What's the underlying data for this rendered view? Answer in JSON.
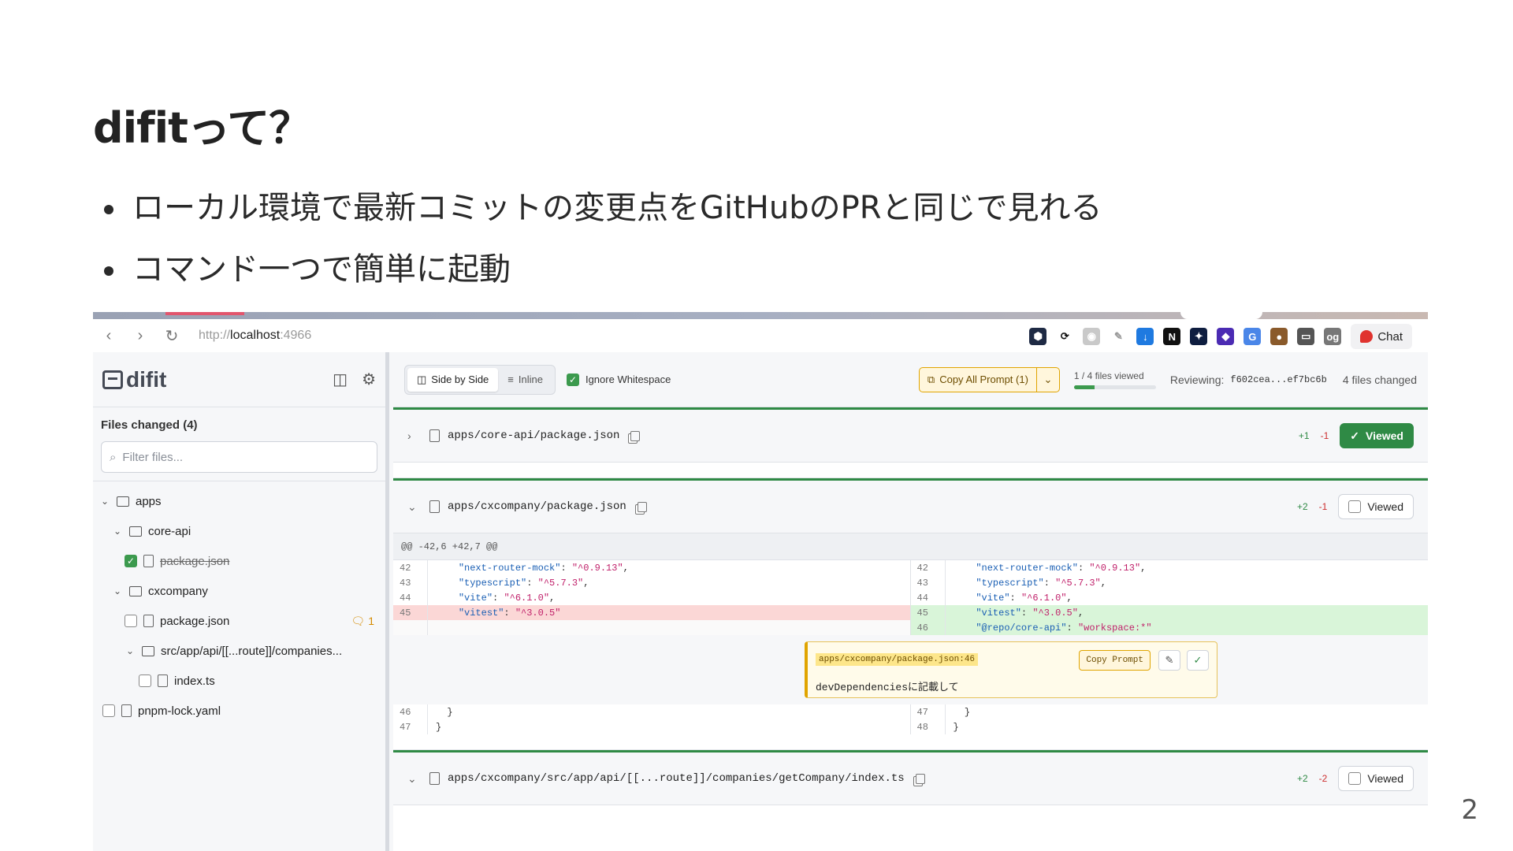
{
  "slide": {
    "title": "difitって？",
    "bullets": [
      "ローカル環境で最新コミットの変更点をGitHubのPRと同じで見れる",
      "コマンド一つで簡単に起動"
    ],
    "page_number": "2"
  },
  "browser": {
    "url_scheme": "http://",
    "url_host": "localhost",
    "url_port": ":4966",
    "chat_label": "Chat"
  },
  "sidebar": {
    "app_name": "difit",
    "files_title": "Files changed (4)",
    "filter_placeholder": "Filter files...",
    "tree": [
      {
        "label": "apps"
      },
      {
        "label": "core-api"
      },
      {
        "label": "package.json"
      },
      {
        "label": "cxcompany"
      },
      {
        "label": "package.json",
        "comments": "1"
      },
      {
        "label": "src/app/api/[[...route]]/companies..."
      },
      {
        "label": "index.ts"
      },
      {
        "label": "pnpm-lock.yaml"
      }
    ]
  },
  "toolbar": {
    "side_by_side": "Side by Side",
    "inline": "Inline",
    "ignore_whitespace": "Ignore Whitespace",
    "copy_all": "Copy All Prompt (1)",
    "files_viewed": "1 / 4 files viewed",
    "files_viewed_fraction": 0.25,
    "reviewing_label": "Reviewing:",
    "reviewing_hash": "f602cea...ef7bc6b",
    "files_changed": "4 files changed"
  },
  "files": [
    {
      "path": "apps/core-api/package.json",
      "add": "+1",
      "del": "-1",
      "viewed_label": "Viewed",
      "viewed": true
    },
    {
      "path": "apps/cxcompany/package.json",
      "add": "+2",
      "del": "-1",
      "viewed_label": "Viewed",
      "viewed": false
    },
    {
      "path": "apps/cxcompany/src/app/api/[[...route]]/companies/getCompany/index.ts",
      "add": "+2",
      "del": "-2",
      "viewed_label": "Viewed",
      "viewed": false
    }
  ],
  "hunk": "@@ -42,6 +42,7 @@",
  "diff_left": [
    {
      "n": "42",
      "key": "\"next-router-mock\"",
      "val": "\"^0.9.13\"",
      "tail": ","
    },
    {
      "n": "43",
      "key": "\"typescript\"",
      "val": "\"^5.7.3\"",
      "tail": ","
    },
    {
      "n": "44",
      "key": "\"vite\"",
      "val": "\"^6.1.0\"",
      "tail": ","
    },
    {
      "n": "45",
      "key": "\"vitest\"",
      "val": "\"^3.0.5\"",
      "tail": ""
    }
  ],
  "diff_right": [
    {
      "n": "42",
      "key": "\"next-router-mock\"",
      "val": "\"^0.9.13\"",
      "tail": ","
    },
    {
      "n": "43",
      "key": "\"typescript\"",
      "val": "\"^5.7.3\"",
      "tail": ","
    },
    {
      "n": "44",
      "key": "\"vite\"",
      "val": "\"^6.1.0\"",
      "tail": ","
    },
    {
      "n": "45",
      "key": "\"vitest\"",
      "val": "\"^3.0.5\"",
      "tail": ","
    },
    {
      "n": "46",
      "key": "\"@repo/core-api\"",
      "val": "\"workspace:*\"",
      "tail": ""
    }
  ],
  "comment": {
    "ref": "apps/cxcompany/package.json:46",
    "text": "devDependenciesに記載して",
    "copy_prompt": "Copy Prompt"
  },
  "diff_after": {
    "left": [
      {
        "n": "46",
        "code": "  }"
      },
      {
        "n": "47",
        "code": "}"
      }
    ],
    "right": [
      {
        "n": "47",
        "code": "  }"
      },
      {
        "n": "48",
        "code": "}"
      }
    ]
  },
  "colors": {
    "accent_green": "#2f8a45",
    "warning_yellow": "#e0a400",
    "chat_red": "#e0332f"
  }
}
